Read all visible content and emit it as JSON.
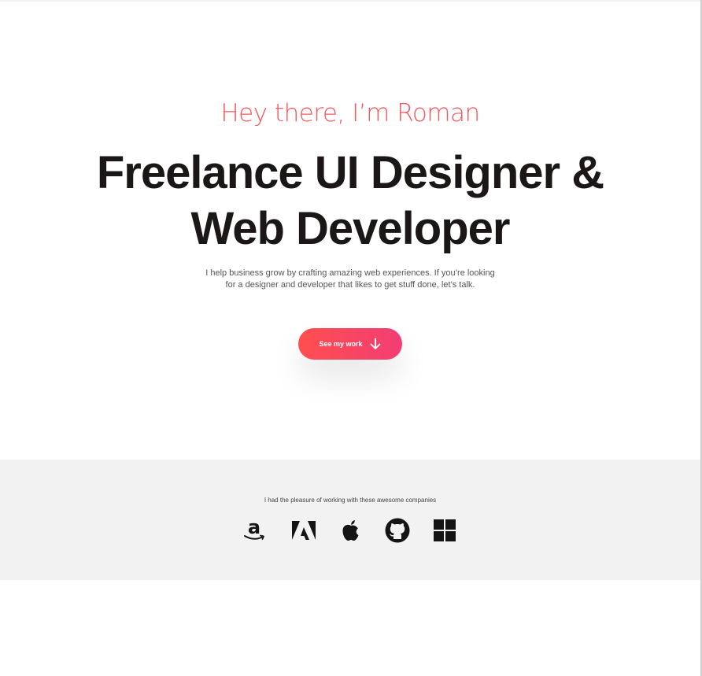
{
  "hero": {
    "greeting": "Hey there, I’m Roman",
    "headline_line1": "Freelance UI Designer &",
    "headline_line2": "Web Developer",
    "intro_line1": "I help business grow by crafting amazing web experiences. If you’re looking",
    "intro_line2": "for a designer and developer that likes to get stuff done, let’s talk.",
    "cta_label": "See my work",
    "cta_icon": "arrow-down-icon"
  },
  "companies": {
    "caption": "I had the pleasure of working with these awesome companies",
    "logos": [
      "amazon-logo",
      "adobe-logo",
      "apple-logo",
      "github-logo",
      "microsoft-logo"
    ]
  },
  "colors": {
    "accent": "#f25a5f",
    "cta_gradient_start": "#ff4f4f",
    "cta_gradient_end": "#f23d74",
    "headline": "#1b1717",
    "band": "#f2f2f2"
  }
}
